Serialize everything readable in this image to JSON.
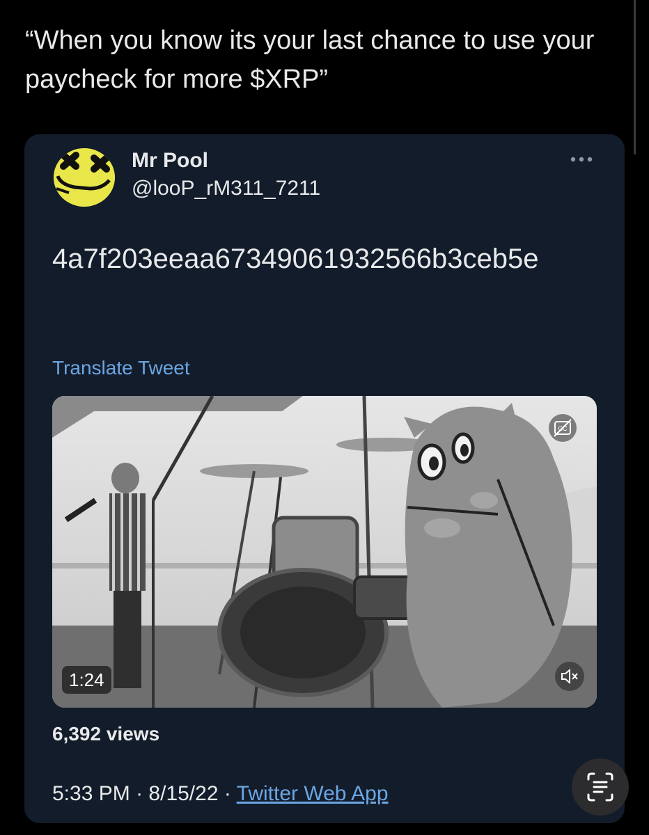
{
  "caption": {
    "text": "“When you know its your last chance to use your paycheck for more $XRP”"
  },
  "tweet": {
    "author": {
      "display_name": "Mr Pool",
      "handle": "@looP_rM311_7211",
      "avatar_icon": "dead-smiley-avatar"
    },
    "more_icon": "more-options-icon",
    "text": "4a7f203eeaa67349061932566b3ceb5e",
    "translate_label": "Translate Tweet",
    "video": {
      "duration": "1:24",
      "cc_icon": "closed-captions-icon",
      "mute_icon": "muted-speaker-icon"
    },
    "views_count": "6,392",
    "views_label": "views",
    "time": "5:33 PM",
    "separator": "·",
    "date": "8/15/22",
    "source": "Twitter Web App"
  },
  "overlay": {
    "lens_icon": "visual-lookup-icon"
  },
  "colors": {
    "background": "#000000",
    "card": "#131c2a",
    "text": "#e7e9ea",
    "link": "#6ba6e3",
    "avatar_yellow": "#e9e64a"
  }
}
